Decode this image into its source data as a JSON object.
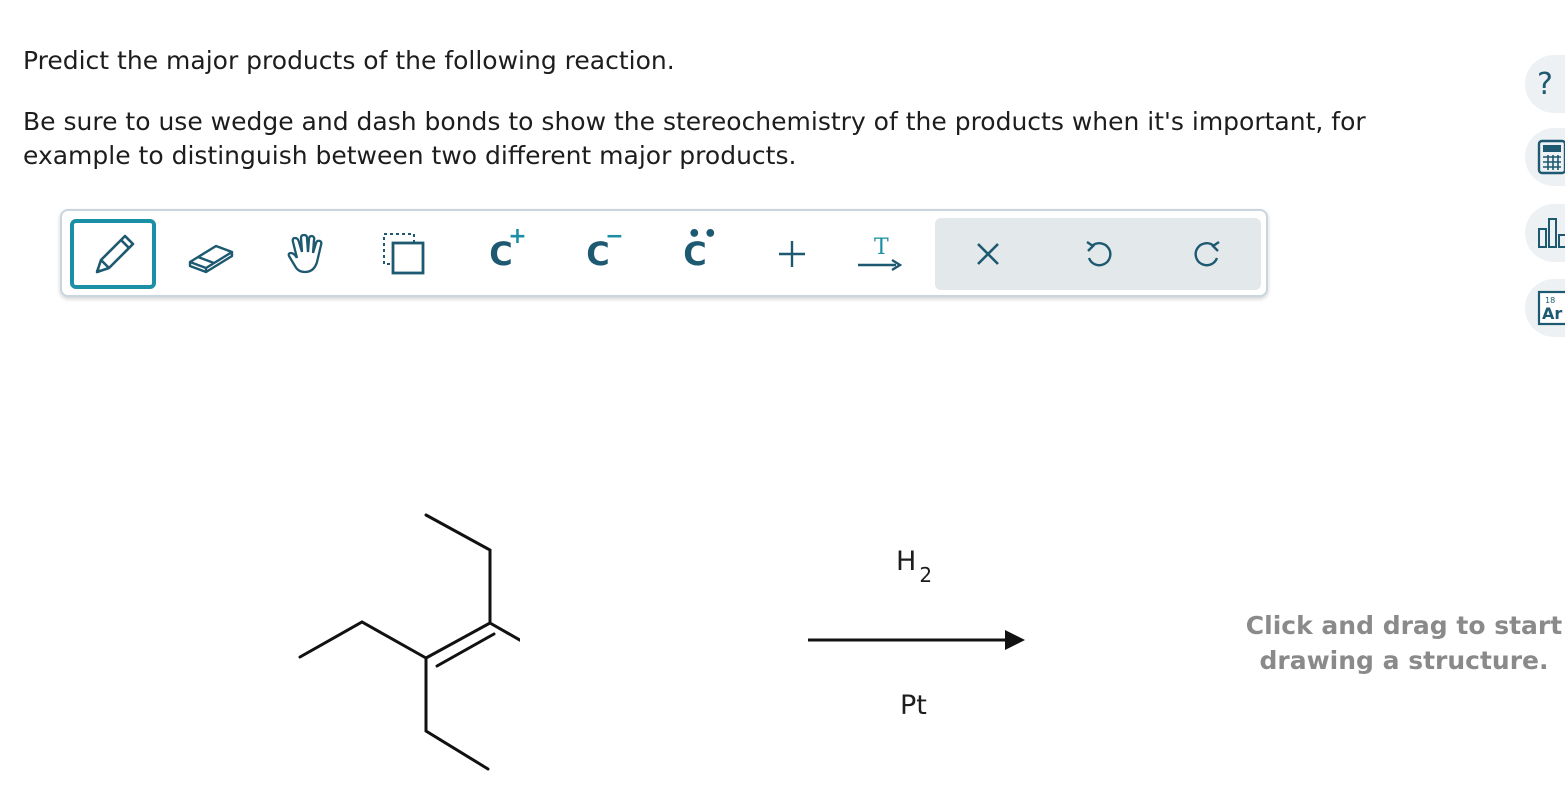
{
  "question": {
    "line1": "Predict the major products of the following reaction.",
    "line2": "Be sure to use wedge and dash bonds to show the stereochemistry of the products when it's important, for example to distinguish between two different major products."
  },
  "toolbar": {
    "selected_tool": "pencil",
    "tools": [
      {
        "name": "pencil",
        "icon": "pencil-icon"
      },
      {
        "name": "eraser",
        "icon": "eraser-icon"
      },
      {
        "name": "hand",
        "icon": "hand-icon"
      },
      {
        "name": "select",
        "icon": "select-box-icon"
      },
      {
        "name": "carbocation",
        "icon": "carbocation-icon",
        "symbol": "C",
        "charge": "+"
      },
      {
        "name": "carbanion",
        "icon": "carbanion-icon",
        "symbol": "C",
        "charge": "−"
      },
      {
        "name": "lone-pair",
        "icon": "lone-pair-icon",
        "symbol": "C"
      },
      {
        "name": "plus",
        "icon": "plus-icon"
      },
      {
        "name": "arrow-text",
        "icon": "text-arrow-icon",
        "symbol": "T"
      },
      {
        "name": "clear",
        "icon": "close-icon"
      },
      {
        "name": "undo",
        "icon": "undo-icon"
      },
      {
        "name": "redo",
        "icon": "redo-icon"
      }
    ]
  },
  "sidebar": {
    "help_symbol": "?",
    "periodic_number": "18",
    "periodic_symbol": "Ar",
    "buttons": [
      "help-icon",
      "calculator-icon",
      "bar-chart-icon",
      "periodic-table-icon"
    ]
  },
  "reaction": {
    "reagent_top": "H",
    "reagent_top_subscript": "2",
    "reagent_bottom": "Pt"
  },
  "canvas_hint": "Click and drag to start drawing a structure.",
  "colors": {
    "accent": "#1a8fa5",
    "icon": "#1d5970",
    "group_bg": "#e3e8eb",
    "hint": "#8a8a8a"
  }
}
